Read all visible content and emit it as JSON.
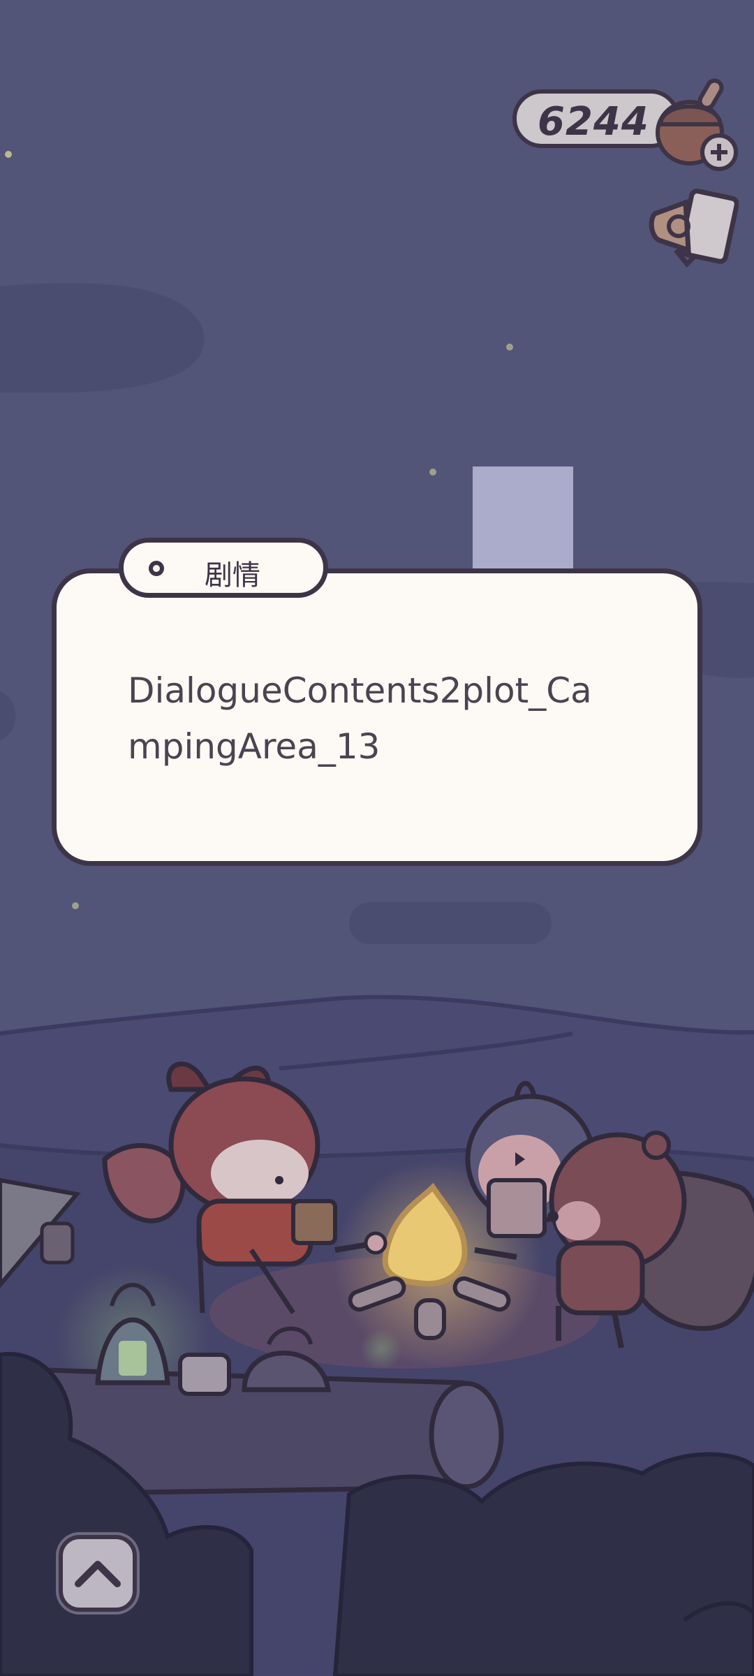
{
  "currency": {
    "value": "6244",
    "icon": "acorn-add-icon"
  },
  "reward": {
    "icon": "ad-video-reward-icon"
  },
  "dialogue": {
    "tab_label": "剧情",
    "text": "DialogueContents2plot_CampingArea_13"
  },
  "controls": {
    "collapse_icon": "chevron-up-icon"
  },
  "colors": {
    "sky": "#525478",
    "dialogue_bg": "#fdfaf5",
    "outline": "#3e3447",
    "placeholder": "#ababcc"
  }
}
